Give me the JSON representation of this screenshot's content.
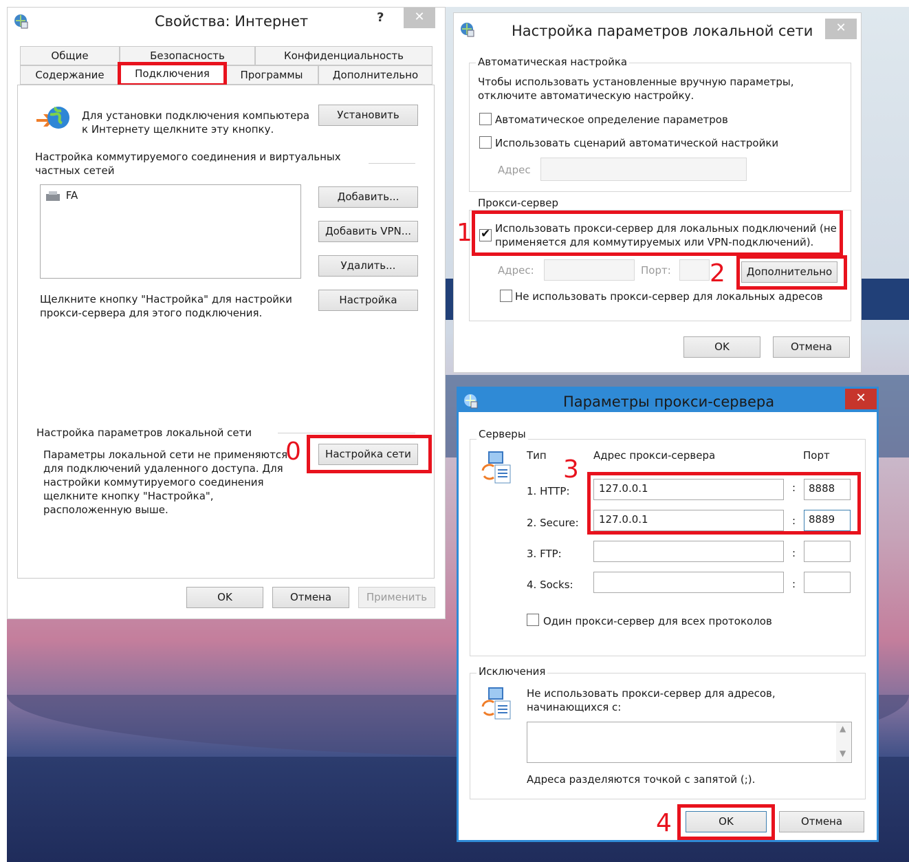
{
  "internet_properties": {
    "title": "Свойства: Интернет",
    "help": "?",
    "close": "✕",
    "tabs_top": [
      "Общие",
      "Безопасность",
      "Конфиденциальность"
    ],
    "tabs_bottom": [
      "Содержание",
      "Подключения",
      "Программы",
      "Дополнительно"
    ],
    "setup_text_1": "Для установки подключения компьютера",
    "setup_text_2": "к Интернету щелкните эту кнопку.",
    "setup_button": "Установить",
    "dialup_title_1": "Настройка коммутируемого соединения и виртуальных",
    "dialup_title_2": "частных сетей",
    "connections": [
      "FA"
    ],
    "add_button": "Добавить...",
    "add_vpn_button": "Добавить VPN...",
    "remove_button": "Удалить...",
    "settings_text_1": "Щелкните кнопку \"Настройка\" для настройки",
    "settings_text_2": "прокси-сервера для этого подключения.",
    "settings_button": "Настройка",
    "lan_title": "Настройка параметров локальной сети",
    "lan_text": [
      "Параметры локальной сети не применяются",
      "для подключений удаленного доступа. Для",
      "настройки коммутируемого соединения",
      "щелкните кнопку \"Настройка\",",
      "расположенную выше."
    ],
    "lan_button": "Настройка сети",
    "ok": "OK",
    "cancel": "Отмена",
    "apply": "Применить"
  },
  "lan_settings": {
    "title": "Настройка параметров локальной сети",
    "close": "✕",
    "auto_group": "Автоматическая настройка",
    "auto_text_1": "Чтобы использовать установленные вручную параметры,",
    "auto_text_2": "отключите автоматическую настройку.",
    "auto_detect": "Автоматическое определение параметров",
    "auto_script": "Использовать сценарий автоматической настройки",
    "address_label": "Адрес",
    "proxy_group": "Прокси-сервер",
    "use_proxy_1": "Использовать прокси-сервер для локальных подключений (не",
    "use_proxy_2": "применяется для коммутируемых или VPN-подключений).",
    "use_proxy_checked": true,
    "proxy_address_label": "Адрес:",
    "proxy_port_label": "Порт:",
    "advanced_button": "Дополнительно",
    "bypass_local": "Не использовать прокси-сервер для локальных адресов",
    "ok": "OK",
    "cancel": "Отмена"
  },
  "proxy_settings": {
    "title": "Параметры прокси-сервера",
    "close": "✕",
    "servers_group": "Серверы",
    "col_type": "Тип",
    "col_address": "Адрес прокси-сервера",
    "col_port": "Порт",
    "rows": [
      {
        "label": "1. HTTP:",
        "address": "127.0.0.1",
        "port": "8888"
      },
      {
        "label": "2. Secure:",
        "address": "127.0.0.1",
        "port": "8889"
      },
      {
        "label": "3. FTP:",
        "address": "",
        "port": ""
      },
      {
        "label": "4. Socks:",
        "address": "",
        "port": ""
      }
    ],
    "colon": ":",
    "same_proxy": "Один прокси-сервер для всех протоколов",
    "exceptions_group": "Исключения",
    "exceptions_text_1": "Не использовать прокси-сервер для адресов,",
    "exceptions_text_2": "начинающихся с:",
    "exceptions_value": "",
    "exceptions_hint": "Адреса разделяются точкой с запятой (;).",
    "ok": "OK",
    "cancel": "Отмена"
  },
  "annotations": [
    "0",
    "1",
    "2",
    "3",
    "4"
  ],
  "colors": {
    "highlight": "#e8121d",
    "close_active": "#c7352c"
  }
}
